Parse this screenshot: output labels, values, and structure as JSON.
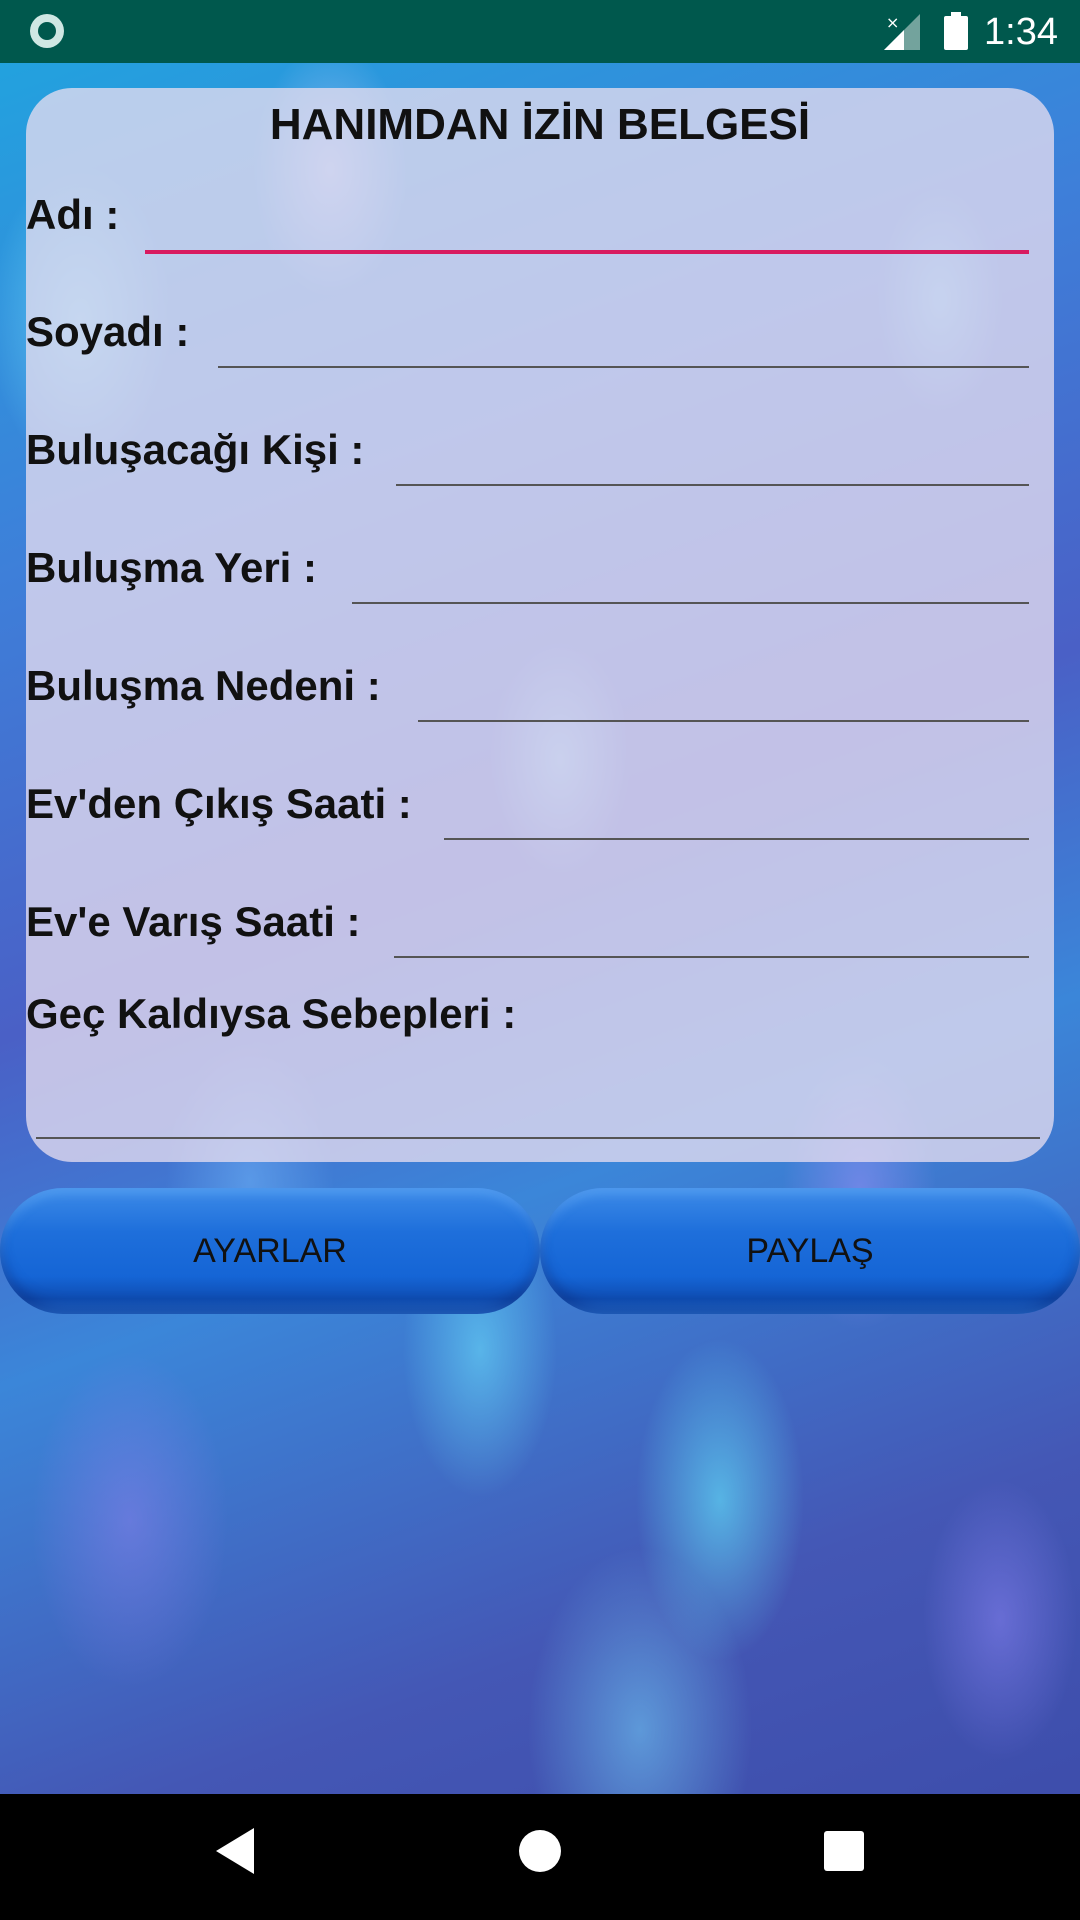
{
  "status_bar": {
    "time": "1:34",
    "icons": [
      "app-status-icon",
      "signal-no-data-icon",
      "battery-icon"
    ]
  },
  "form": {
    "title": "HANIMDAN İZİN BELGESİ",
    "fields": [
      {
        "label": "Adı :",
        "value": "",
        "focused": true
      },
      {
        "label": "Soyadı :",
        "value": ""
      },
      {
        "label": "Buluşacağı Kişi :",
        "value": ""
      },
      {
        "label": "Buluşma Yeri :",
        "value": ""
      },
      {
        "label": "Buluşma Nedeni :",
        "value": ""
      },
      {
        "label": "Ev'den Çıkış Saati :",
        "value": ""
      },
      {
        "label": "Ev'e Varış Saati :",
        "value": ""
      },
      {
        "label": "Geç Kaldıysa Sebepleri :",
        "value": ""
      }
    ]
  },
  "buttons": {
    "settings_label": "AYARLAR",
    "share_label": "PAYLAŞ"
  },
  "colors": {
    "status_bar": "#00584d",
    "focus_underline": "#d81b60",
    "button_blue": "#1565d6"
  },
  "nav_bar": {
    "icons": [
      "back-icon",
      "home-icon",
      "recents-icon"
    ]
  }
}
